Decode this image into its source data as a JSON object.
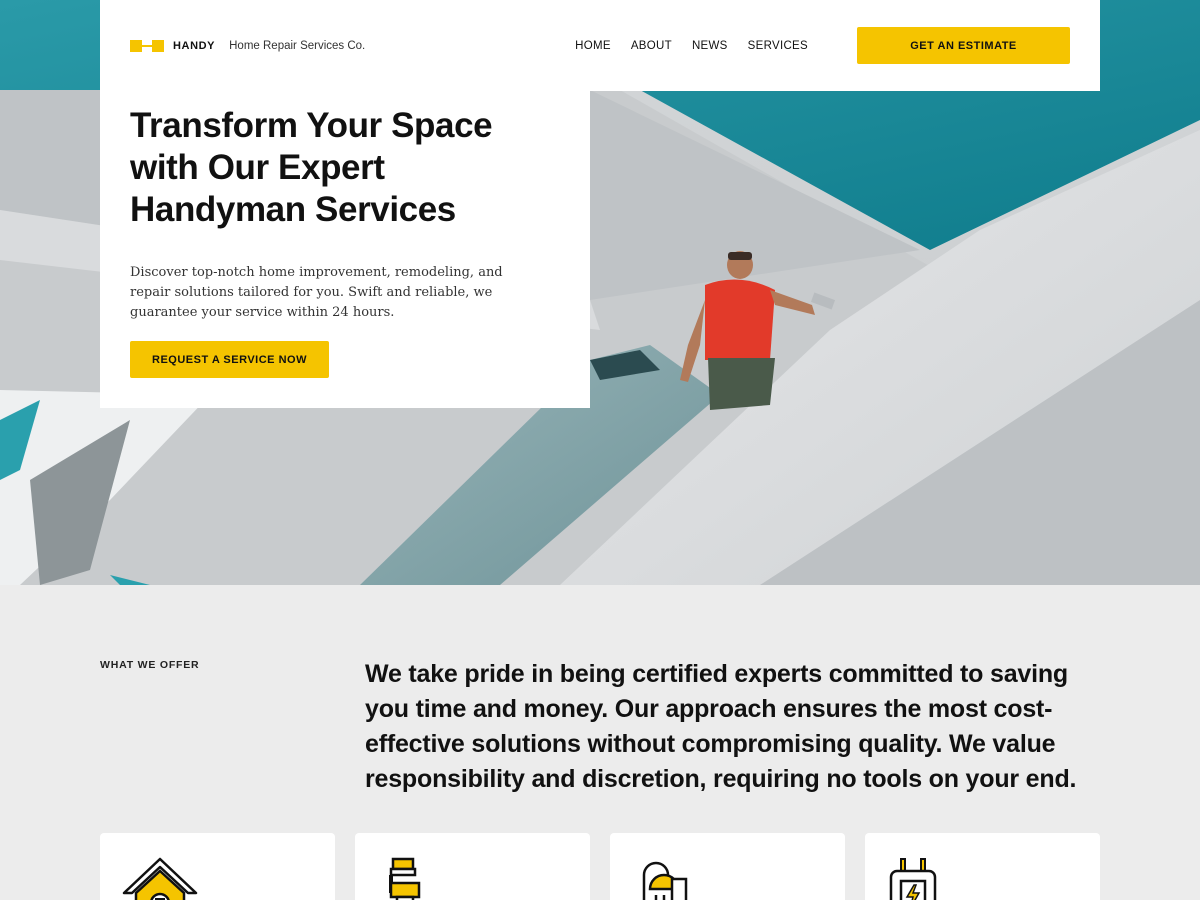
{
  "brand": {
    "name": "HANDY",
    "tagline": "Home Repair Services Co."
  },
  "nav": {
    "items": [
      "HOME",
      "ABOUT",
      "NEWS",
      "SERVICES"
    ],
    "cta": "GET AN ESTIMATE"
  },
  "hero": {
    "title_lines": [
      "Transform Your Space",
      "with Our Expert",
      "Handyman Services"
    ],
    "description": "Discover top-notch home improvement, remodeling, and repair solutions tailored for you. Swift and reliable, we guarantee your service within 24 hours.",
    "cta": "REQUEST A SERVICE NOW"
  },
  "offer": {
    "label": "WHAT WE OFFER",
    "text": "We take pride in being certified experts committed to saving you time and money. Our approach ensures the most cost-effective solutions without compromising quality. We value responsibility and discretion, requiring no tools on your end."
  },
  "service_cards": [
    {
      "icon": "house-wrench-icon"
    },
    {
      "icon": "paint-roller-icon"
    },
    {
      "icon": "shower-icon"
    },
    {
      "icon": "electric-outlet-icon"
    }
  ],
  "colors": {
    "accent": "#f5c400",
    "teal": "#1a8f9c",
    "background": "#ececec"
  }
}
